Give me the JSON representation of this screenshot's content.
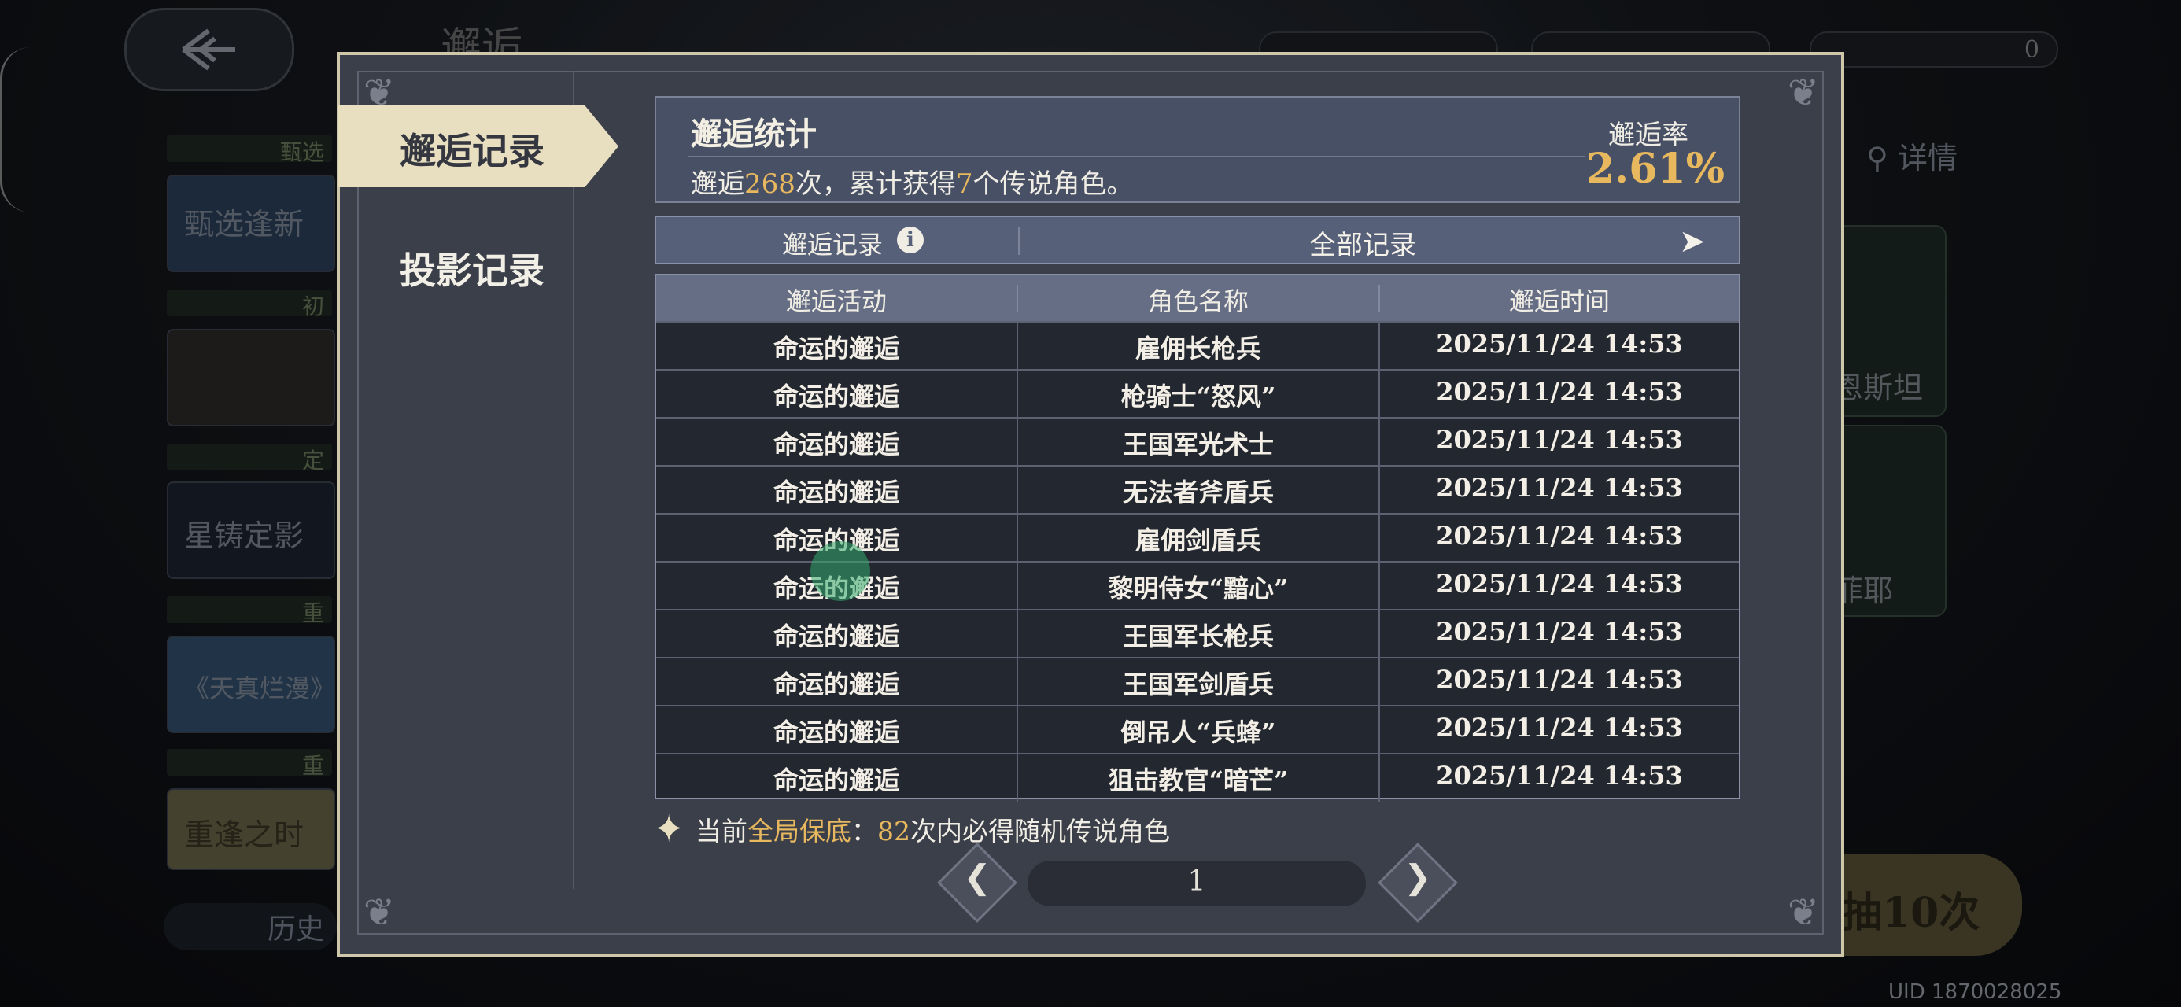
{
  "background": {
    "screen_title": "邂逅",
    "resource_value": "0",
    "details_label": "详情",
    "side_tags": [
      "甄选",
      "初",
      "定",
      "重",
      "重"
    ],
    "side_cards": [
      "甄选逢新",
      "",
      "星铸定影",
      "《天真烂漫》",
      "重逢之时"
    ],
    "right_card_texts": [
      "恩斯坦",
      "菲耶"
    ],
    "history_label": "历史",
    "big_button_text": "抽10次",
    "uid": "UID 1870028025"
  },
  "modal": {
    "nav": {
      "active_tab": "邂逅记录",
      "inactive_tab": "投影记录"
    },
    "stats": {
      "title": "邂逅统计",
      "text_prefix": "邂逅",
      "count": "268",
      "text_mid": "次，累计获得",
      "legend_count": "7",
      "text_suffix": "个传说角色。",
      "rate_label": "邂逅率",
      "rate_value": "2.61%"
    },
    "filter": {
      "label": "邂逅记录",
      "info_icon": "i",
      "value": "全部记录",
      "arrow_icon": "chevron-right-icon"
    },
    "table": {
      "columns": [
        "邂逅活动",
        "角色名称",
        "邂逅时间"
      ],
      "rows": [
        [
          "命运的邂逅",
          "雇佣长枪兵",
          "2025/11/24 14:53"
        ],
        [
          "命运的邂逅",
          "枪骑士“怒风”",
          "2025/11/24 14:53"
        ],
        [
          "命运的邂逅",
          "王国军光术士",
          "2025/11/24 14:53"
        ],
        [
          "命运的邂逅",
          "无法者斧盾兵",
          "2025/11/24 14:53"
        ],
        [
          "命运的邂逅",
          "雇佣剑盾兵",
          "2025/11/24 14:53"
        ],
        [
          "命运的邂逅",
          "黎明侍女“黯心”",
          "2025/11/24 14:53"
        ],
        [
          "命运的邂逅",
          "王国军长枪兵",
          "2025/11/24 14:53"
        ],
        [
          "命运的邂逅",
          "王国军剑盾兵",
          "2025/11/24 14:53"
        ],
        [
          "命运的邂逅",
          "倒吊人“兵蜂”",
          "2025/11/24 14:53"
        ],
        [
          "命运的邂逅",
          "狙击教官“暗芒”",
          "2025/11/24 14:53"
        ]
      ]
    },
    "pity": {
      "prefix": "当前",
      "highlight": "全局保底",
      "colon": "：",
      "count": "82",
      "suffix": "次内必得随机传说角色"
    },
    "pagination": {
      "page": "1"
    }
  }
}
